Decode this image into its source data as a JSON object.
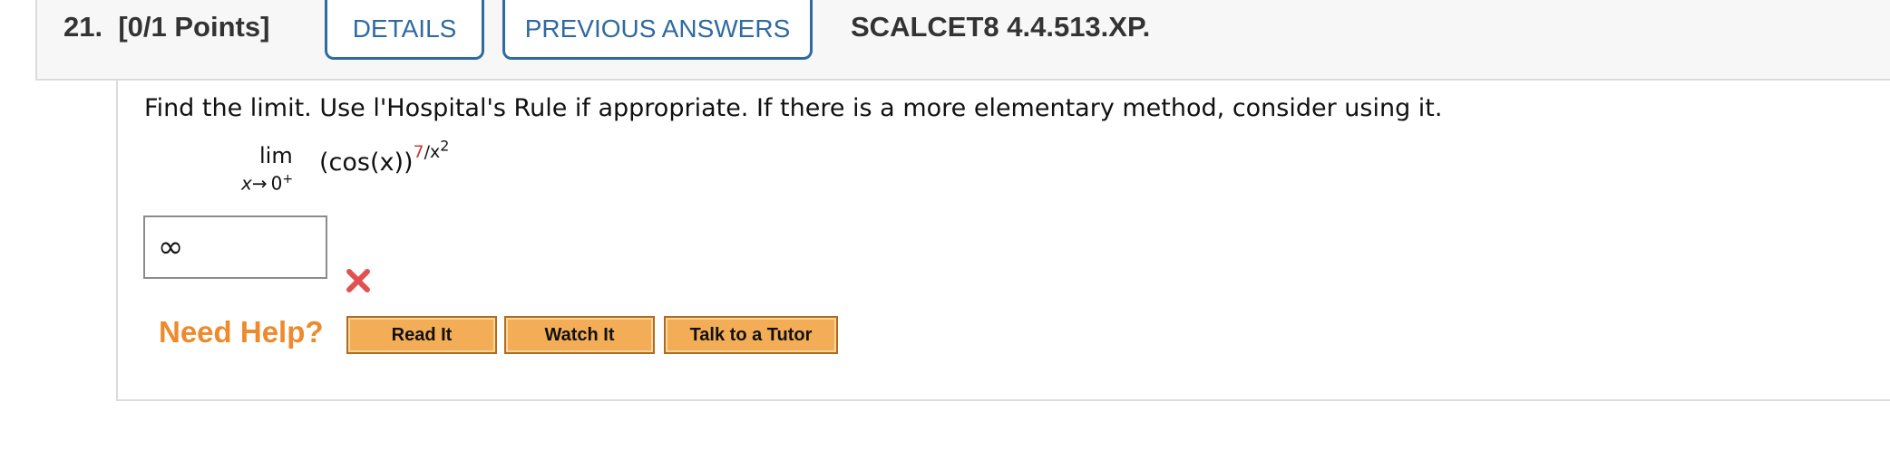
{
  "header": {
    "question_number": "21.",
    "points": "[0/1 Points]",
    "details_label": "DETAILS",
    "previous_answers_label": "PREVIOUS ANSWERS",
    "question_code": "SCALCET8 4.4.513.XP."
  },
  "question": {
    "prompt": "Find the limit. Use l'Hospital's Rule if appropriate. If there is a more elementary method, consider using it.",
    "limit": {
      "word": "lim",
      "subscript_var": "x",
      "subscript_arrow": "→",
      "subscript_target": "0",
      "subscript_side": "+",
      "base": "(cos(x))",
      "exp_numerator": "7",
      "exp_rest": "/x",
      "exp_power": "2"
    }
  },
  "answer": {
    "value": "∞",
    "status": "incorrect",
    "status_icon": "x-mark-icon",
    "status_color": "#e05252"
  },
  "help": {
    "label": "Need Help?",
    "buttons": [
      "Read It",
      "Watch It",
      "Talk to a Tutor"
    ]
  },
  "colors": {
    "accent_blue": "#2f6aa0",
    "help_orange": "#ee8a2c",
    "button_orange": "#f3ad57",
    "exponent_red": "#d23a3a"
  }
}
